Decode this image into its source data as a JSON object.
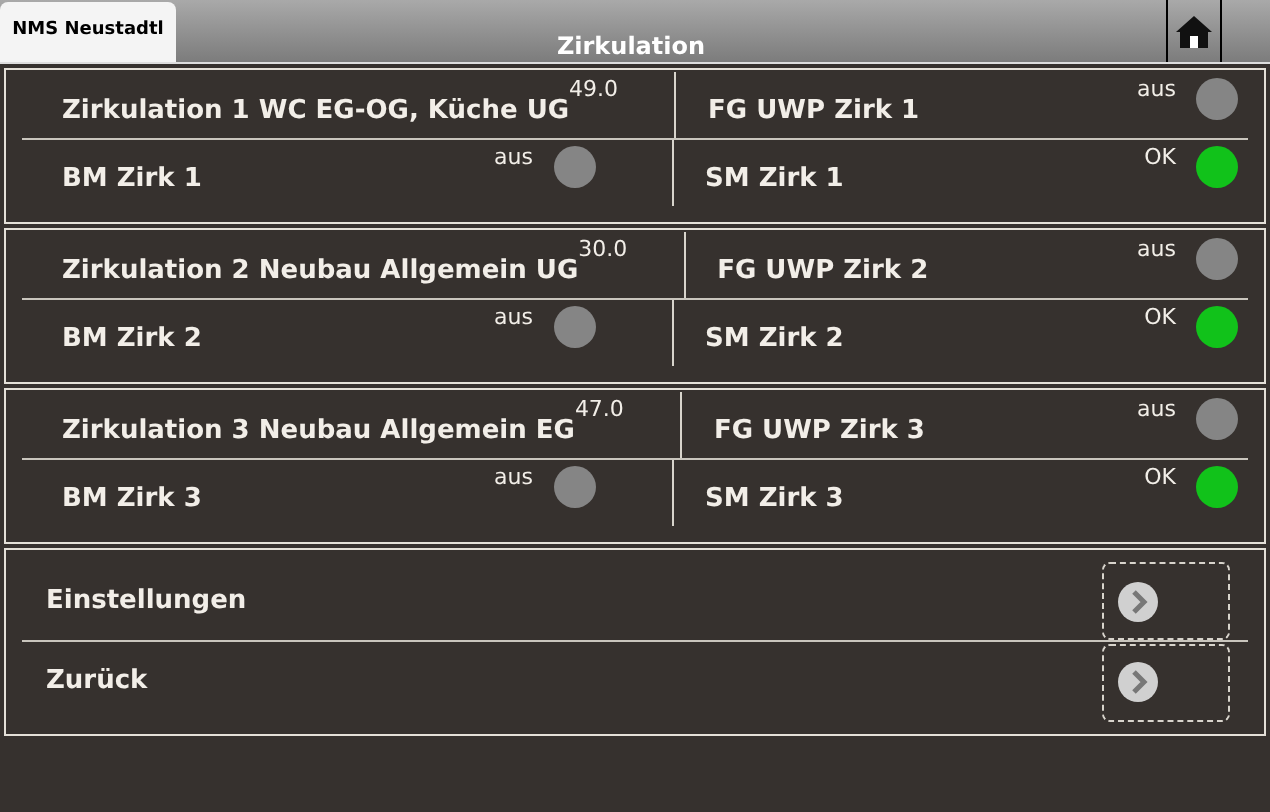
{
  "tab": {
    "label": "NMS Neustadtl",
    "selected": true
  },
  "title": "Zirkulation",
  "groups": [
    {
      "rows": [
        [
          {
            "kind": "value",
            "label": "Zirkulation 1 WC EG-OG, Küche UG",
            "value": "49.0"
          },
          {
            "kind": "lamp",
            "label": "FG UWP Zirk 1",
            "status": "aus",
            "on": false
          }
        ],
        [
          {
            "kind": "lamp",
            "label": "BM Zirk 1",
            "status": "aus",
            "on": false
          },
          {
            "kind": "lamp",
            "label": "SM Zirk 1",
            "status": "OK",
            "on": true
          }
        ]
      ]
    },
    {
      "rows": [
        [
          {
            "kind": "value",
            "label": "Zirkulation 2 Neubau Allgemein UG",
            "value": "30.0"
          },
          {
            "kind": "lamp",
            "label": "FG UWP Zirk 2",
            "status": "aus",
            "on": false
          }
        ],
        [
          {
            "kind": "lamp",
            "label": "BM Zirk 2",
            "status": "aus",
            "on": false
          },
          {
            "kind": "lamp",
            "label": "SM Zirk 2",
            "status": "OK",
            "on": true
          }
        ]
      ]
    },
    {
      "rows": [
        [
          {
            "kind": "value",
            "label": "Zirkulation 3 Neubau Allgemein EG",
            "value": "47.0"
          },
          {
            "kind": "lamp",
            "label": "FG UWP Zirk 3",
            "status": "aus",
            "on": false
          }
        ],
        [
          {
            "kind": "lamp",
            "label": "BM Zirk 3",
            "status": "aus",
            "on": false
          },
          {
            "kind": "lamp",
            "label": "SM Zirk 3",
            "status": "OK",
            "on": true
          }
        ]
      ]
    }
  ],
  "nav": [
    {
      "label": "Einstellungen"
    },
    {
      "label": "Zurück"
    }
  ]
}
